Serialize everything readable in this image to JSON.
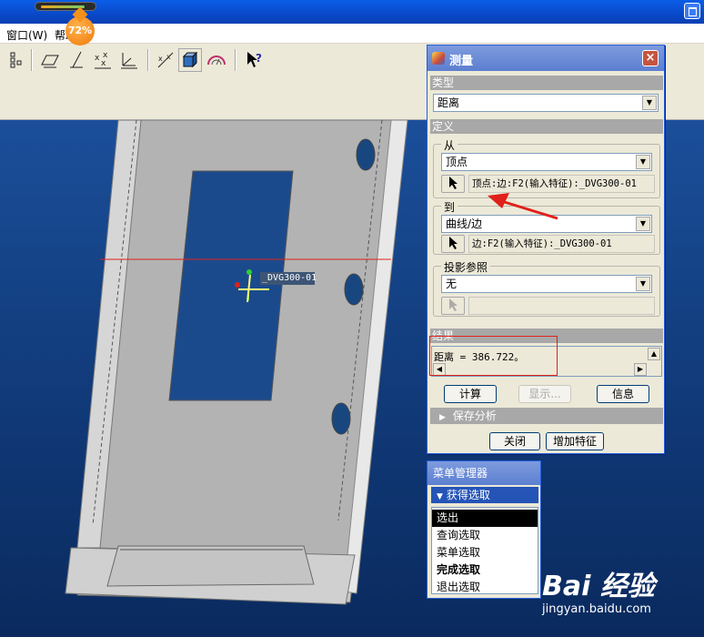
{
  "progress": {
    "fill_fraction": 0.85,
    "badge_text": "72%"
  },
  "menu": {
    "window": "窗口(W)",
    "help": "帮助"
  },
  "toolbar": {
    "icons": [
      "tree-layout-icon",
      "datum-plane-icon",
      "datum-axis-icon",
      "datum-point-icon",
      "coordinate-system-icon",
      "spin-center-icon",
      "shading-box-icon",
      "view-orient-icon",
      "whats-this-icon"
    ]
  },
  "model": {
    "csys_label": "_DVG300-01"
  },
  "measure": {
    "title": "测量",
    "type_section": "类型",
    "type_value": "距离",
    "definition_section": "定义",
    "from_label": "从",
    "from_type": "顶点",
    "from_ref": "顶点:边:F2(输入特征):_DVG300-01",
    "to_label": "到",
    "to_type": "曲线/边",
    "to_ref": "边:F2(输入特征):_DVG300-01",
    "proj_label": "投影参照",
    "proj_value": "无",
    "result_section": "结果",
    "result_text": "距离 = 386.722。",
    "compute_btn": "计算",
    "display_btn": "显示...",
    "info_btn": "信息",
    "save_analysis": "保存分析",
    "close_btn": "关闭",
    "add_feature_btn": "增加特征"
  },
  "menu_manager": {
    "title": "菜单管理器",
    "header": "获得选取",
    "items": [
      "选出",
      "查询选取",
      "菜单选取",
      "完成选取",
      "退出选取"
    ]
  },
  "watermark": {
    "logo": "Bai 经验",
    "url": "jingyan.baidu.com"
  },
  "colors": {
    "titlebar": "#0a5ee8",
    "viewport": "#123d7e",
    "annotation_red": "#e0201a",
    "section_gray": "#a8a8a8"
  }
}
